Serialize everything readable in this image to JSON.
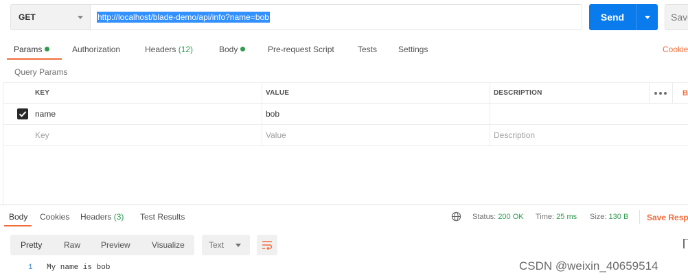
{
  "request": {
    "method": "GET",
    "url": "http://localhost/blade-demo/api/info?name=bob",
    "send_label": "Send",
    "save_label": "Save"
  },
  "req_tabs": [
    {
      "label": "Params",
      "active": true,
      "dot": true
    },
    {
      "label": "Authorization"
    },
    {
      "label": "Headers",
      "count": "(12)"
    },
    {
      "label": "Body",
      "dot": true
    },
    {
      "label": "Pre-request Script"
    },
    {
      "label": "Tests"
    },
    {
      "label": "Settings"
    }
  ],
  "cookies_link": "Cookies",
  "query_params": {
    "title": "Query Params",
    "columns": {
      "key": "KEY",
      "value": "VALUE",
      "description": "DESCRIPTION",
      "bulk_edit": "Bulk Edit"
    },
    "rows": [
      {
        "checked": true,
        "key": "name",
        "value": "bob",
        "description": ""
      }
    ],
    "placeholders": {
      "key": "Key",
      "value": "Value",
      "description": "Description"
    }
  },
  "response": {
    "tabs": [
      {
        "label": "Body",
        "active": true
      },
      {
        "label": "Cookies"
      },
      {
        "label": "Headers",
        "count": "(3)"
      },
      {
        "label": "Test Results"
      }
    ],
    "status_label": "Status:",
    "status_value": "200 OK",
    "time_label": "Time:",
    "time_value": "25 ms",
    "size_label": "Size:",
    "size_value": "130 B",
    "save_response": "Save Response",
    "formats": [
      "Pretty",
      "Raw",
      "Preview",
      "Visualize"
    ],
    "language": "Text",
    "lines": [
      {
        "no": "1",
        "text": "My name is bob"
      }
    ]
  },
  "watermark": "CSDN @weixin_40659514",
  "colors": {
    "accent": "#f26b3a",
    "send": "#097bed",
    "success": "#2e9c4e",
    "selection": "#3390ff"
  }
}
